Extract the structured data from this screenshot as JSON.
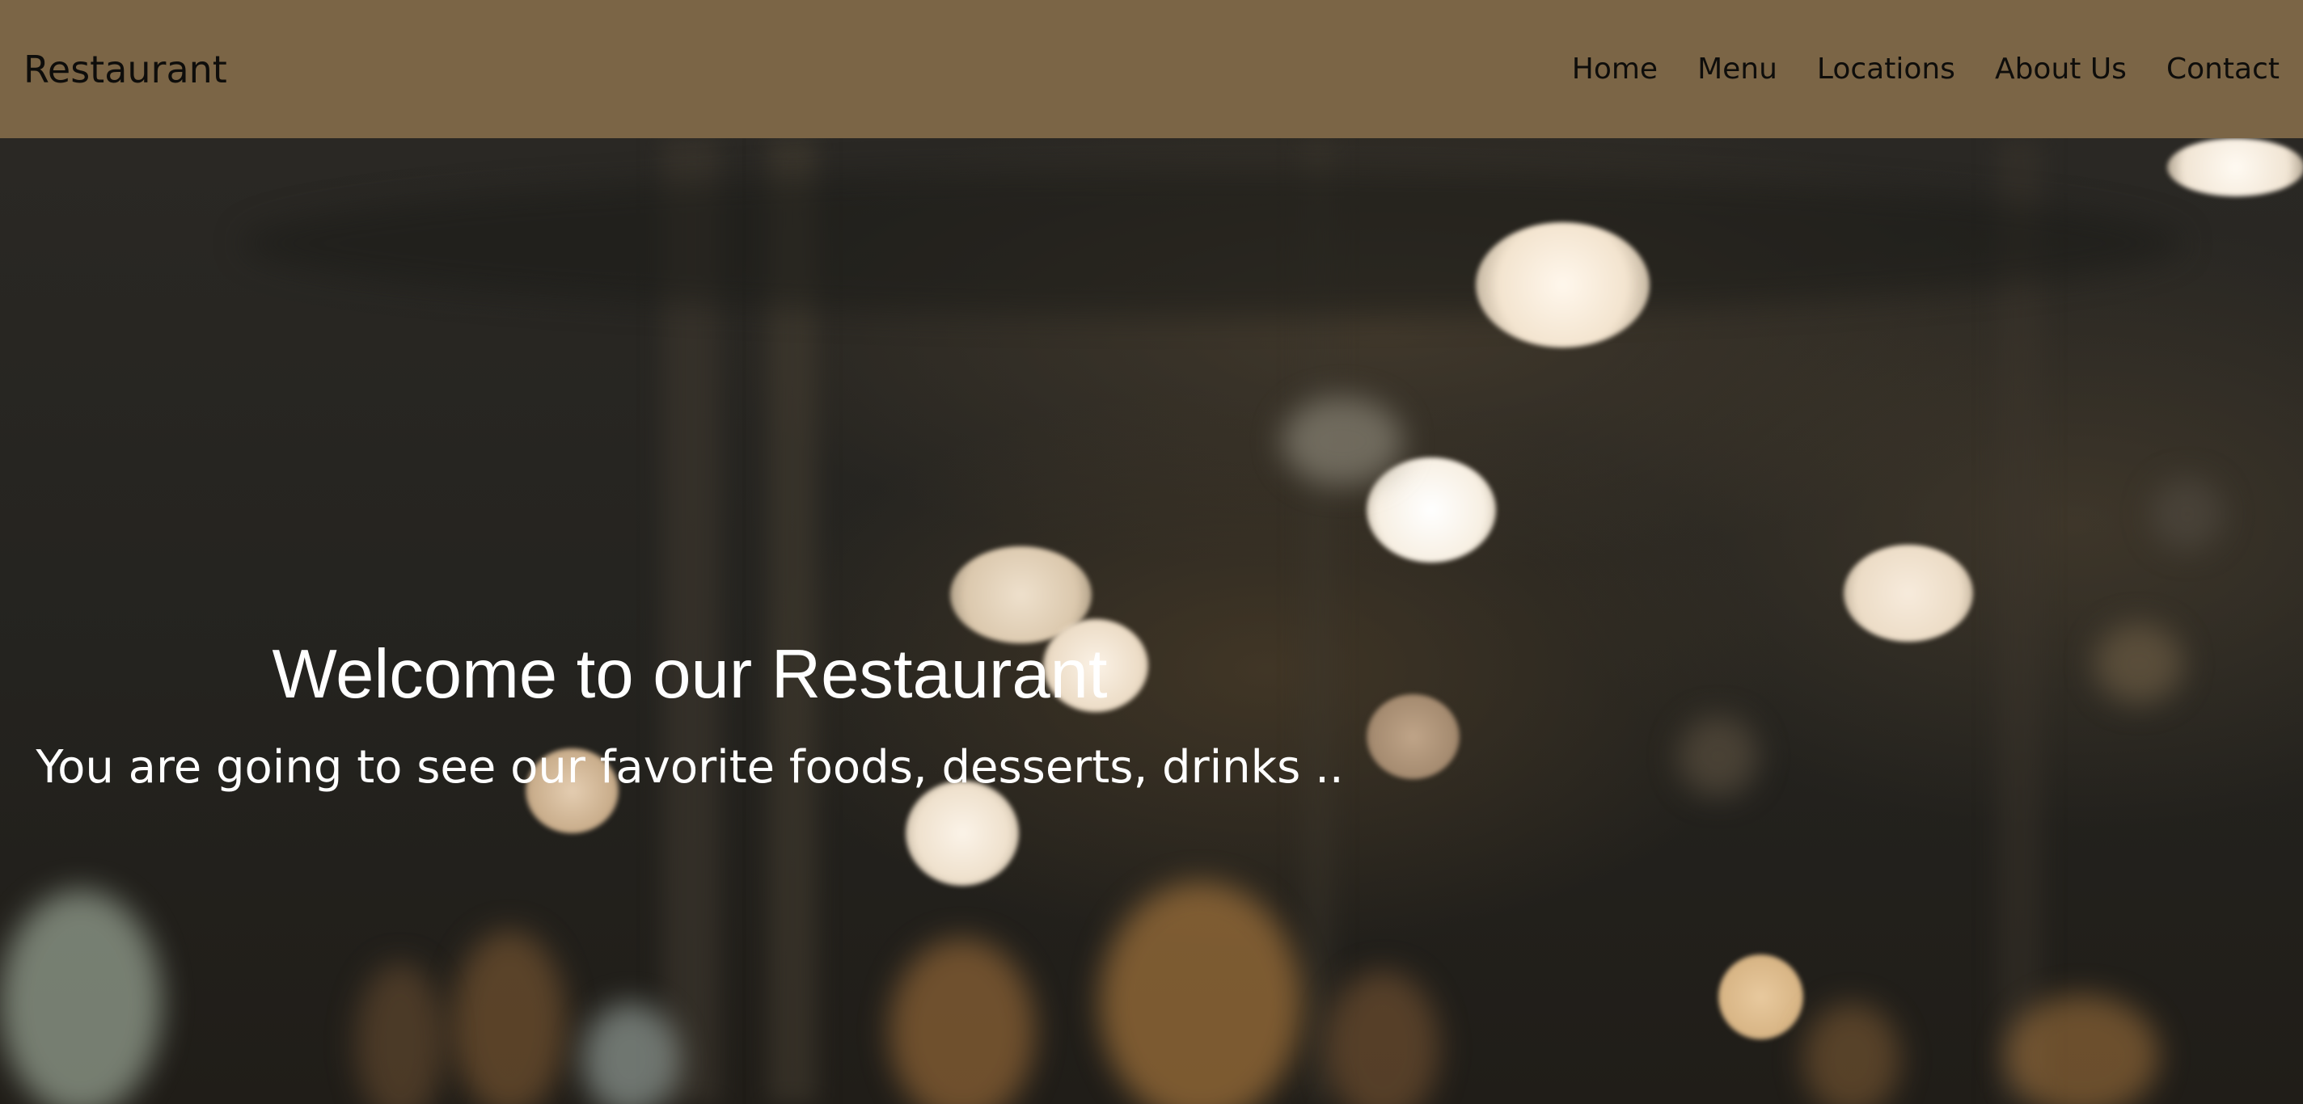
{
  "header": {
    "brand": "Restaurant",
    "nav": [
      {
        "label": "Home"
      },
      {
        "label": "Menu"
      },
      {
        "label": "Locations"
      },
      {
        "label": "About Us"
      },
      {
        "label": "Contact"
      }
    ]
  },
  "hero": {
    "title": "Welcome to our Restaurant",
    "subtitle": "You are going to see our favorite foods, desserts, drinks .."
  },
  "colors": {
    "header_bg": "#7b6546",
    "header_text": "#0e0d0b",
    "hero_text": "#ffffff"
  }
}
